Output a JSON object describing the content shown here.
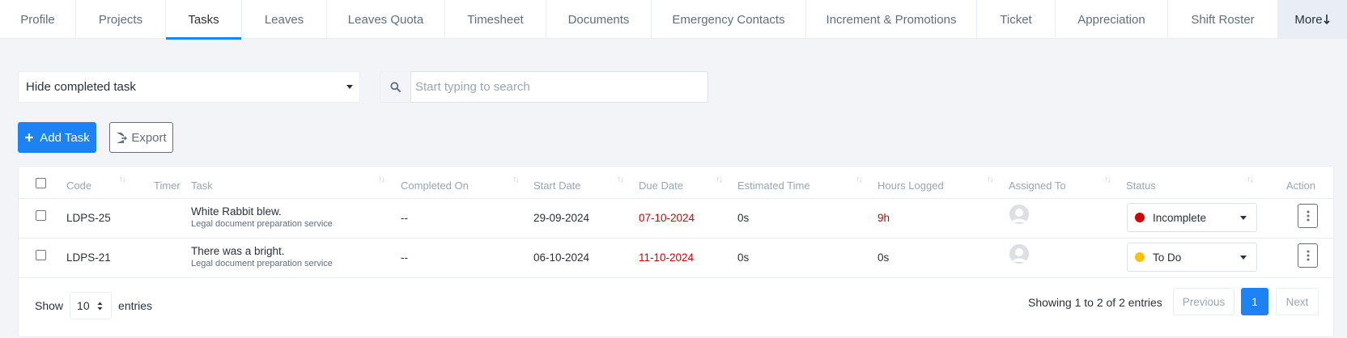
{
  "tabs": [
    {
      "label": "Profile",
      "active": false
    },
    {
      "label": "Projects",
      "active": false
    },
    {
      "label": "Tasks",
      "active": true
    },
    {
      "label": "Leaves",
      "active": false
    },
    {
      "label": "Leaves Quota",
      "active": false
    },
    {
      "label": "Timesheet",
      "active": false
    },
    {
      "label": "Documents",
      "active": false
    },
    {
      "label": "Emergency Contacts",
      "active": false
    },
    {
      "label": "Increment & Promotions",
      "active": false
    },
    {
      "label": "Ticket",
      "active": false
    },
    {
      "label": "Appreciation",
      "active": false
    },
    {
      "label": "Shift Roster",
      "active": false
    }
  ],
  "more_label": "More",
  "filters": {
    "task_filter_value": "Hide completed task",
    "search_placeholder": "Start typing to search"
  },
  "actions": {
    "add_task_label": "Add Task",
    "export_label": "Export"
  },
  "table": {
    "headers": {
      "code": "Code",
      "timer": "Timer",
      "task": "Task",
      "completed_on": "Completed On",
      "start_date": "Start Date",
      "due_date": "Due Date",
      "estimated_time": "Estimated Time",
      "hours_logged": "Hours Logged",
      "assigned_to": "Assigned To",
      "status": "Status",
      "action": "Action"
    },
    "rows": [
      {
        "code": "LDPS-25",
        "task_title": "White Rabbit blew.",
        "task_project": "Legal document preparation service",
        "completed_on": "--",
        "start_date": "29-09-2024",
        "due_date": "07-10-2024",
        "estimated_time": "0s",
        "hours_logged": "9h",
        "status": "Incomplete",
        "status_color": "#d30000"
      },
      {
        "code": "LDPS-21",
        "task_title": "There was a bright.",
        "task_project": "Legal document preparation service",
        "completed_on": "--",
        "start_date": "06-10-2024",
        "due_date": "11-10-2024",
        "estimated_time": "0s",
        "hours_logged": "0s",
        "status": "To Do",
        "status_color": "#f5c308"
      }
    ]
  },
  "footer": {
    "show_label": "Show",
    "page_length": "10",
    "entries_label": "entries",
    "info": "Showing 1 to 2 of 2 entries",
    "previous_label": "Previous",
    "current_page": "1",
    "next_label": "Next"
  },
  "colors": {
    "accent": "#1d82f5",
    "overdue": "#d30000"
  }
}
